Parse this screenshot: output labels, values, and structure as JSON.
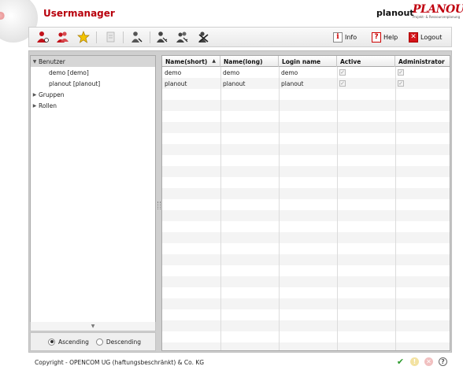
{
  "header": {
    "app_title": "Usermanager",
    "user": "planout",
    "brand_name": "PLANOUT",
    "brand_tagline": "Projekt- & Ressourcenplanung"
  },
  "toolbar": {
    "info_label": "Info",
    "help_label": "Help",
    "logout_label": "Logout",
    "info_glyph": "i",
    "help_glyph": "?",
    "logout_glyph": "✕"
  },
  "tree": {
    "items": [
      {
        "label": "Benutzer",
        "arrow": "▼"
      },
      {
        "label": "demo [demo]"
      },
      {
        "label": "planout [planout]"
      },
      {
        "label": "Gruppen",
        "arrow": "▶"
      },
      {
        "label": "Rollen",
        "arrow": "▶"
      }
    ],
    "scroll_glyph": "▼"
  },
  "sort": {
    "ascending_label": "Ascending",
    "descending_label": "Descending",
    "selected": "ascending"
  },
  "table": {
    "columns": [
      {
        "label": "Name(short)",
        "sort": "▲"
      },
      {
        "label": "Name(long)"
      },
      {
        "label": "Login name"
      },
      {
        "label": "Active"
      },
      {
        "label": "Administrator"
      }
    ],
    "rows": [
      {
        "short": "demo",
        "long": "demo",
        "login": "demo",
        "active": true,
        "admin": true
      },
      {
        "short": "planout",
        "long": "planout",
        "login": "planout",
        "active": true,
        "admin": true
      }
    ],
    "check_glyph": "✓"
  },
  "footer": {
    "copyright": "Copyright - OPENCOM UG (haftungsbeschränkt) & Co. KG",
    "ok_glyph": "✔",
    "warn_glyph": "!",
    "error_glyph": "✕",
    "help_glyph": "?"
  },
  "colors": {
    "accent": "#b8000c",
    "frame": "#cfcfcf",
    "selected_row": "#d6d6d6"
  }
}
